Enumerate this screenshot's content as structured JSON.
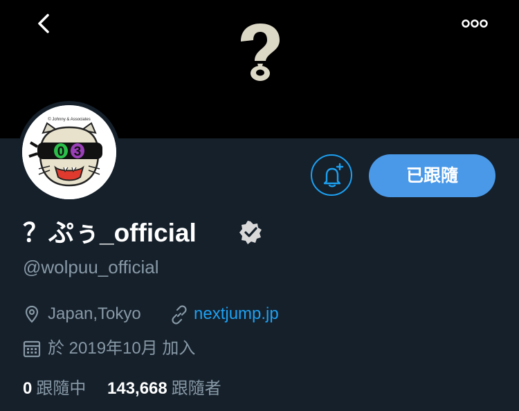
{
  "header": {
    "back_icon": "chevron-left-icon",
    "more_icon": "ellipsis-icon",
    "banner_logo_icon": "question-mark-logo"
  },
  "avatar": {
    "icon": "cat-mask-avatar",
    "copyright": "© Johnny & Associates",
    "number_left": "0",
    "number_right": "3"
  },
  "actions": {
    "notify_icon": "bell-plus-icon",
    "follow_label": "已跟隨"
  },
  "profile": {
    "display_name": "？ぷぅ_official",
    "verified_icon": "verified-badge-icon",
    "handle": "@wolpuu_official",
    "location": "Japan,Tokyo",
    "location_icon": "location-pin-icon",
    "link": "nextjump.jp",
    "link_icon": "link-icon",
    "joined": "於 2019年10月 加入",
    "calendar_icon": "calendar-icon"
  },
  "stats": {
    "following_count": "0",
    "following_label": "跟隨中",
    "followers_count": "143,668",
    "followers_label": "跟隨者"
  },
  "colors": {
    "background": "#15202b",
    "banner": "#000000",
    "accent": "#1da1f2",
    "follow_button": "#4a99e9",
    "secondary_text": "#8899a6"
  }
}
